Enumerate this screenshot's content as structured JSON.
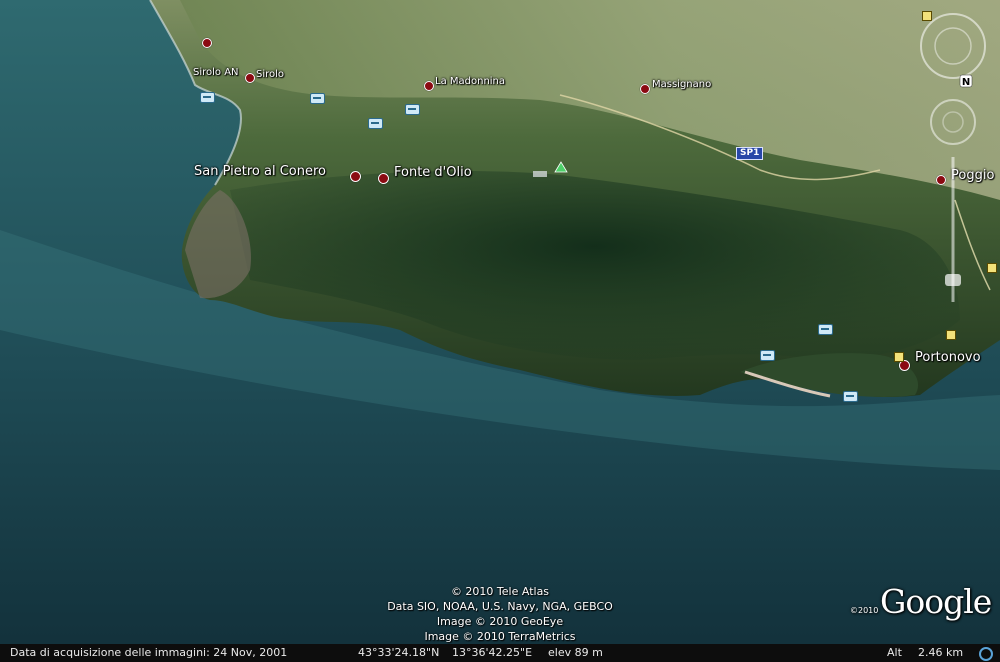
{
  "places": {
    "sirolo_an": "Sirolo AN",
    "sirolo": "Sirolo",
    "la_madonnina": "La Madonnina",
    "massignano": "Massignano",
    "san_pietro": "San Pietro al Conero",
    "fonte_olio": "Fonte d'Olio",
    "poggio": "Poggio",
    "portonovo": "Portonovo"
  },
  "road": {
    "sp1": "SP1"
  },
  "compass": {
    "north": "N"
  },
  "credits": {
    "line1": "© 2010 Tele Atlas",
    "line2": "Data SIO, NOAA, U.S. Navy, NGA, GEBCO",
    "line3": "Image © 2010 GeoEye",
    "line4": "Image © 2010 TerraMetrics"
  },
  "logo": {
    "year": "©2010",
    "word": "Google"
  },
  "status": {
    "imagery_date": "Data di acquisizione delle immagini: 24 Nov, 2001",
    "lat": "43°33'24.18\"N",
    "lon": "13°36'42.25\"E",
    "elev": "elev  89 m",
    "alt_label": "Alt",
    "alt_value": "2.46 km"
  },
  "colors": {
    "sea_light": "#2f6a70",
    "sea_dark": "#12303a",
    "land": "#3e5a36",
    "farmland": "#8a9a6a",
    "pin": "#8b0a12"
  }
}
